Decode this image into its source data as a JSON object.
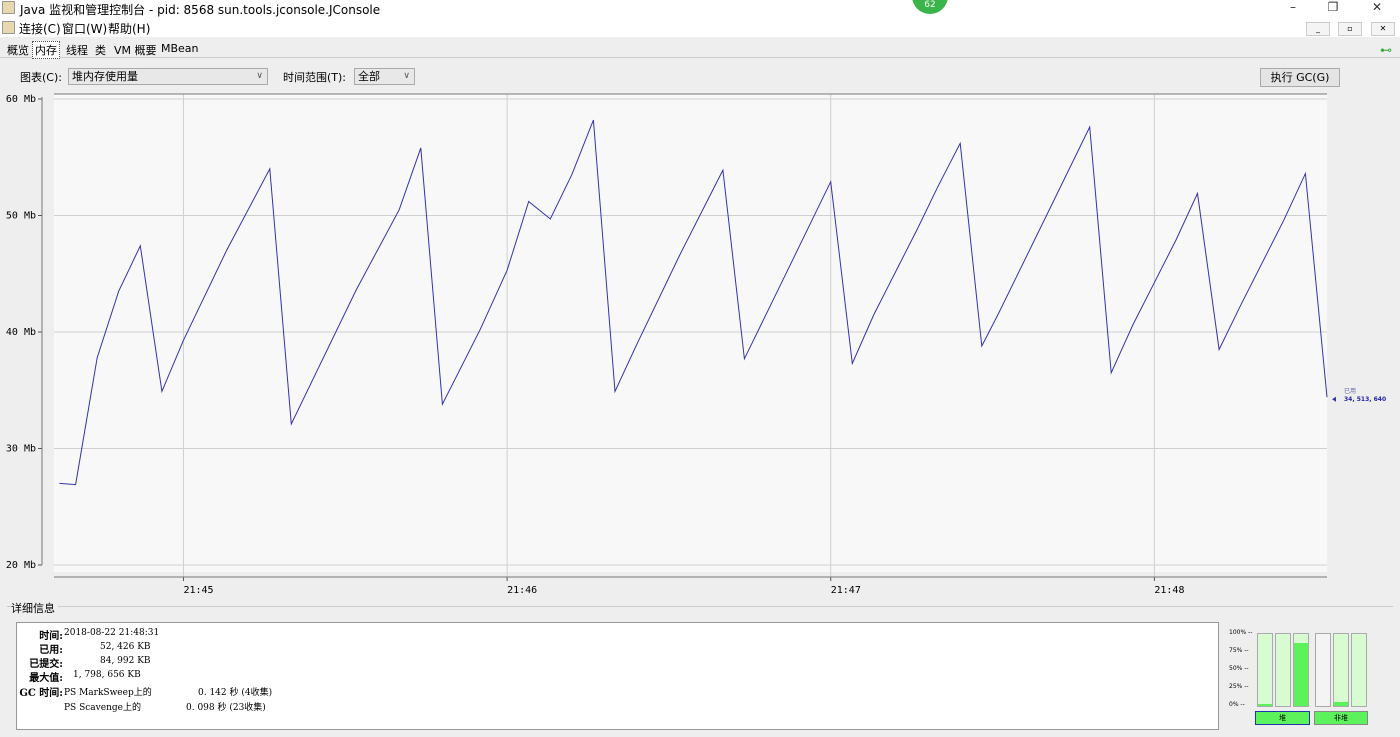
{
  "window": {
    "title": "Java 监视和管理控制台 - pid: 8568 sun.tools.jconsole.JConsole",
    "badge": "62"
  },
  "menu": [
    "连接(C)",
    "窗口(W)",
    "帮助(H)"
  ],
  "tabs": [
    "概览",
    "内存",
    "线程",
    "类",
    "VM 概要",
    "MBean"
  ],
  "selected_tab": "内存",
  "controls": {
    "chart_label": "图表(C):",
    "chart_value": "堆内存使用量",
    "range_label": "时间范围(T):",
    "range_value": "全部",
    "gc_button": "执行 GC(G)"
  },
  "chart_data": {
    "type": "line",
    "y_ticks": [
      "20 Mb",
      "30 Mb",
      "40 Mb",
      "50 Mb",
      "60 Mb"
    ],
    "ylim": [
      20,
      60
    ],
    "x_ticks": [
      "21:45",
      "21:46",
      "21:47",
      "21:48"
    ],
    "xlim": [
      "21:44:36",
      "21:48:32"
    ],
    "grid": true,
    "line_color": "#3333aa",
    "series": [
      {
        "name": "已用",
        "current_value": "34, 513, 640",
        "points": [
          [
            "21:44:37",
            27.0
          ],
          [
            "21:44:40",
            26.9
          ],
          [
            "21:44:44",
            37.8
          ],
          [
            "21:44:48",
            43.5
          ],
          [
            "21:44:52",
            47.4
          ],
          [
            "21:44:56",
            34.9
          ],
          [
            "21:45:00",
            39.3
          ],
          [
            "21:45:08",
            47.0
          ],
          [
            "21:45:16",
            54.0
          ],
          [
            "21:45:20",
            32.1
          ],
          [
            "21:45:32",
            43.6
          ],
          [
            "21:45:40",
            50.5
          ],
          [
            "21:45:44",
            55.8
          ],
          [
            "21:45:48",
            33.8
          ],
          [
            "21:45:55",
            40.2
          ],
          [
            "21:46:00",
            45.3
          ],
          [
            "21:46:04",
            51.2
          ],
          [
            "21:46:08",
            49.7
          ],
          [
            "21:46:12",
            53.5
          ],
          [
            "21:46:16",
            58.2
          ],
          [
            "21:46:20",
            34.9
          ],
          [
            "21:46:24",
            38.9
          ],
          [
            "21:46:32",
            46.6
          ],
          [
            "21:46:40",
            53.9
          ],
          [
            "21:46:44",
            37.7
          ],
          [
            "21:46:52",
            45.3
          ],
          [
            "21:47:00",
            52.9
          ],
          [
            "21:47:04",
            37.3
          ],
          [
            "21:47:08",
            41.5
          ],
          [
            "21:47:16",
            48.8
          ],
          [
            "21:47:20",
            52.6
          ],
          [
            "21:47:24",
            56.2
          ],
          [
            "21:47:28",
            38.8
          ],
          [
            "21:47:31",
            41.5
          ],
          [
            "21:47:40",
            50.0
          ],
          [
            "21:47:48",
            57.6
          ],
          [
            "21:47:52",
            36.5
          ],
          [
            "21:47:56",
            40.6
          ],
          [
            "21:48:04",
            47.9
          ],
          [
            "21:48:08",
            51.9
          ],
          [
            "21:48:12",
            38.5
          ],
          [
            "21:48:16",
            42.3
          ],
          [
            "21:48:24",
            49.6
          ],
          [
            "21:48:28",
            53.6
          ],
          [
            "21:48:32",
            34.4
          ]
        ]
      }
    ]
  },
  "details": {
    "title": "详细信息",
    "rows": [
      {
        "k": "时间:",
        "v": "2018-08-22 21:48:31"
      },
      {
        "k": "已用:",
        "v": "52, 426 KB"
      },
      {
        "k": "已提交:",
        "v": "84, 992 KB"
      },
      {
        "k": "最大值:",
        "v": "1, 798, 656 KB"
      }
    ],
    "gc_label": "GC 时间:",
    "gc": [
      {
        "name": "PS MarkSweep上的",
        "time": "0. 142 秒 (4收集)"
      },
      {
        "name": "PS Scavenge上的",
        "time": "0. 098 秒 (23收集)"
      }
    ]
  },
  "pools": {
    "pct_labels": [
      "100% --",
      "75% --",
      "50% --",
      "25% --",
      "0% --"
    ],
    "heap_label": "堆",
    "nonheap_label": "非堆",
    "heap_fractions": [
      0.03,
      0.0,
      0.88
    ],
    "nonheap_fractions": [
      0.0,
      0.06,
      0.0
    ],
    "fill_color": "#5cf25c",
    "bg_color": "#d8fbd2"
  }
}
